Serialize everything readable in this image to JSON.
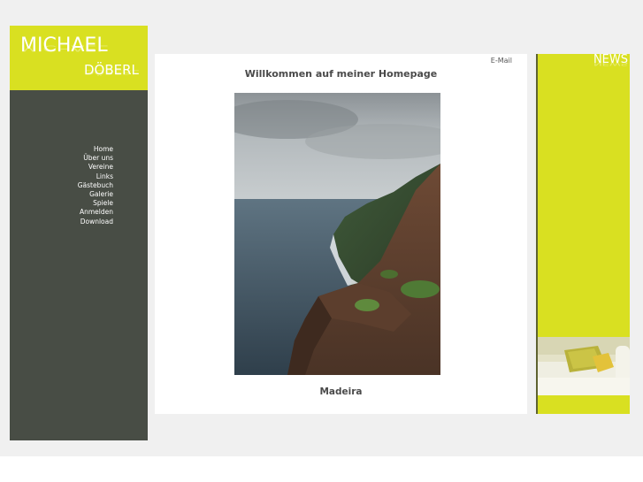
{
  "logo": {
    "first_name": "MICHAEL",
    "last_name": "DÖBERL"
  },
  "nav": {
    "items": [
      "Home",
      "Über uns",
      "Vereine",
      "Links",
      "Gästebuch",
      "Galerie",
      "Spiele",
      "Anmelden",
      "Download"
    ]
  },
  "main": {
    "email_link": "E-Mail",
    "headline": "Willkommen auf meiner Homepage",
    "caption": "Madeira"
  },
  "news": {
    "title": "NEWS"
  },
  "colors": {
    "accent": "#d9e021",
    "sidebar": "#484d45",
    "background": "#f0f0f0"
  }
}
